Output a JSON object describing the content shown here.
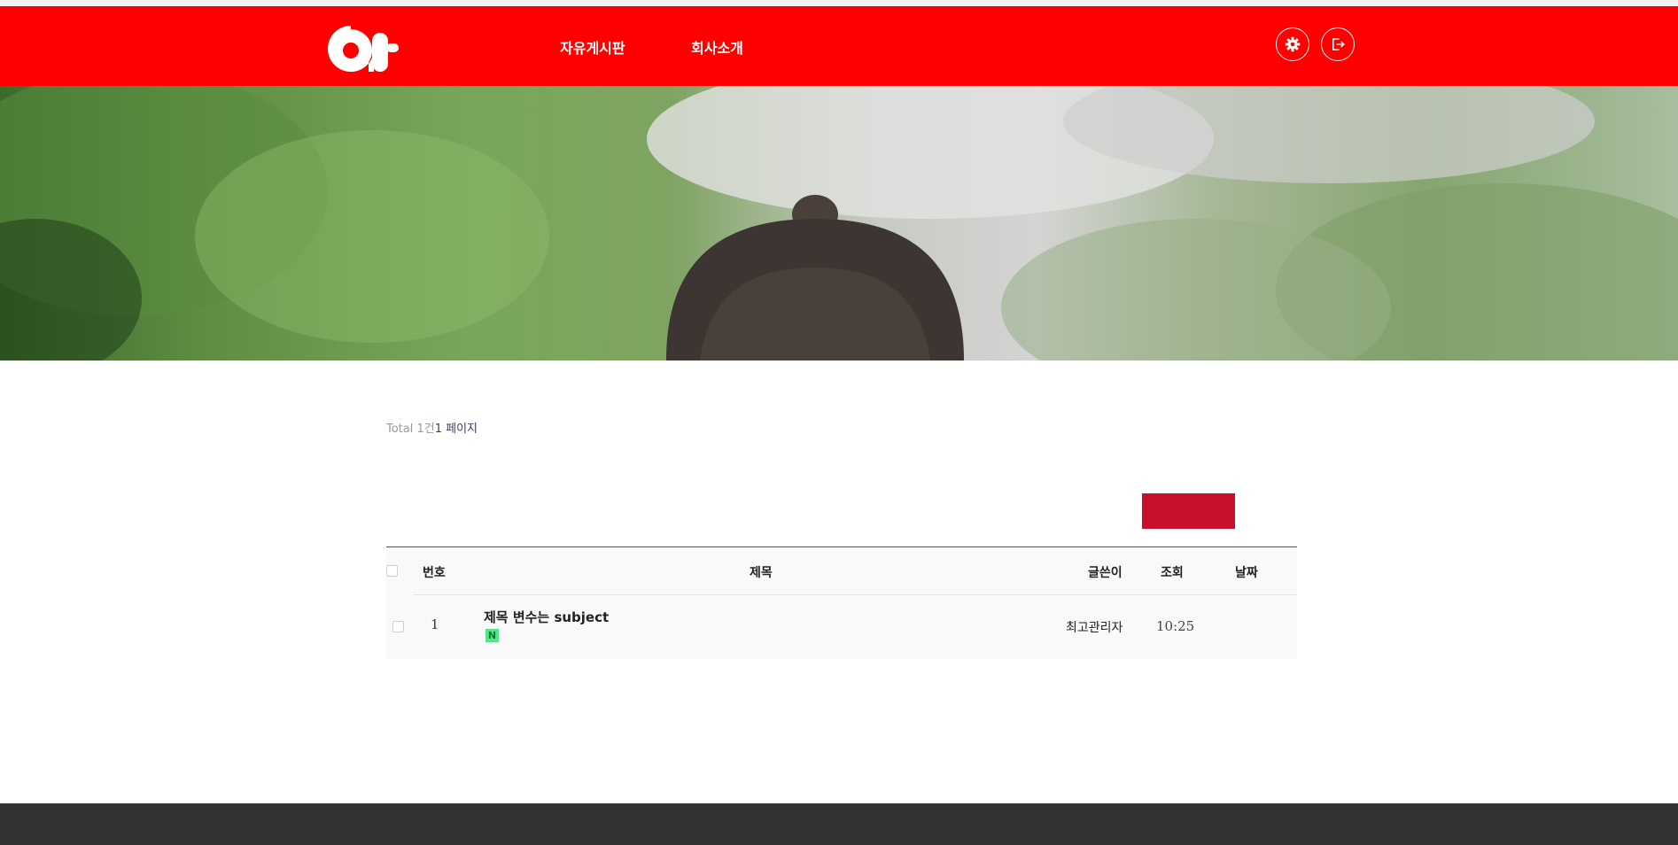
{
  "header": {
    "logo_text": "at",
    "nav": [
      {
        "label": "자유게시판"
      },
      {
        "label": "회사소개"
      }
    ],
    "brand_color": "#ff0000",
    "icons": [
      "gear-icon",
      "logout-icon"
    ]
  },
  "board": {
    "total": {
      "total_label": "Total 1건",
      "page_label": "1 페이지"
    },
    "write_button_color": "#c8102e",
    "columns": {
      "num": "번호",
      "subject": "제목",
      "writer": "글쓴이",
      "hits": "조회",
      "date": "날짜"
    },
    "rows": [
      {
        "num": "1",
        "subject": "제목 변수는 subject",
        "new_badge": "N",
        "writer": "최고관리자",
        "hits": "10:25",
        "date": ""
      }
    ]
  }
}
